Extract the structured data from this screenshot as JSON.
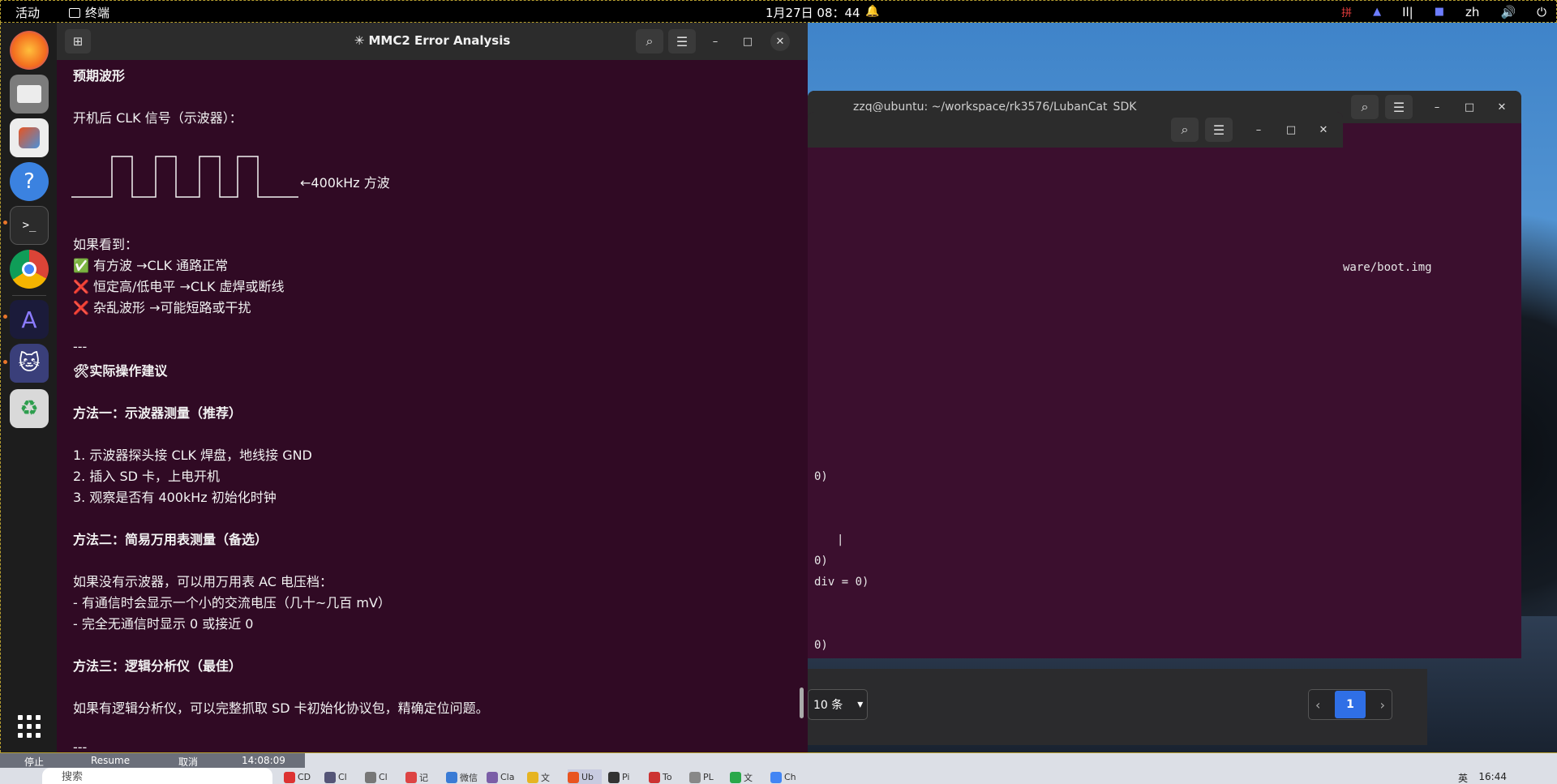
{
  "topbar": {
    "activities": "活动",
    "app_name": "终端",
    "clock": "1月27日 08：44",
    "tray_lang": "zh"
  },
  "back_terminal": {
    "title": "zzq@ubuntu: ~/workspace/rk3576/LubanCat_SDK",
    "line": "ware/boot.img"
  },
  "mid_terminal": {
    "lines": [
      "0)",
      "|",
      "0)",
      "div = 0)",
      "0)"
    ]
  },
  "pager": {
    "size_label": "10 条",
    "current_page": "1",
    "prev": "‹",
    "next": "›"
  },
  "main_terminal": {
    "title": "✳ MMC2 Error Analysis",
    "heading_wave": "预期波形",
    "clk_intro": "开机后 CLK 信号（示波器）：",
    "wave_label": "←400kHz 方波",
    "if_seen": "如果看到：",
    "ok_line": "✅ 有方波 →CLK 通路正常",
    "bad_line1": "❌ 恒定高/低电平 →CLK 虚焊或断线",
    "bad_line2": "❌ 杂乱波形 →可能短路或干扰",
    "hr": "---",
    "tips_heading": "🛠实际操作建议",
    "method1_title": "方法一：示波器测量（推荐）",
    "step1": "1. 示波器探头接 CLK 焊盘，地线接 GND",
    "step2": "2. 插入 SD 卡，上电开机",
    "step3": "3. 观察是否有 400kHz 初始化时钟",
    "method2_title": "方法二：简易万用表测量（备选）",
    "m2_intro": "如果没有示波器，可以用万用表 AC 电压档：",
    "m2_b1": "- 有通信时会显示一个小的交流电压（几十~几百 mV）",
    "m2_b2": "- 完全无通信时显示 0 或接近 0",
    "method3_title": "方法三：逻辑分析仪（最佳）",
    "m3_text": "如果有逻辑分析仪，可以完整抓取 SD 卡初始化协议包，精确定位问题。",
    "hr2": "---"
  },
  "taskbar": {
    "strip_items": [
      "停止",
      "Resume",
      "取消",
      "14:08:09"
    ],
    "search_placeholder": "搜索",
    "apps": [
      "CD",
      "Cl",
      "Cl",
      "记",
      "微信",
      "Cla",
      "文",
      "Ub",
      "Pi",
      "To",
      "PL",
      "文",
      "Ch"
    ],
    "lang": "英",
    "time": "16:44"
  }
}
